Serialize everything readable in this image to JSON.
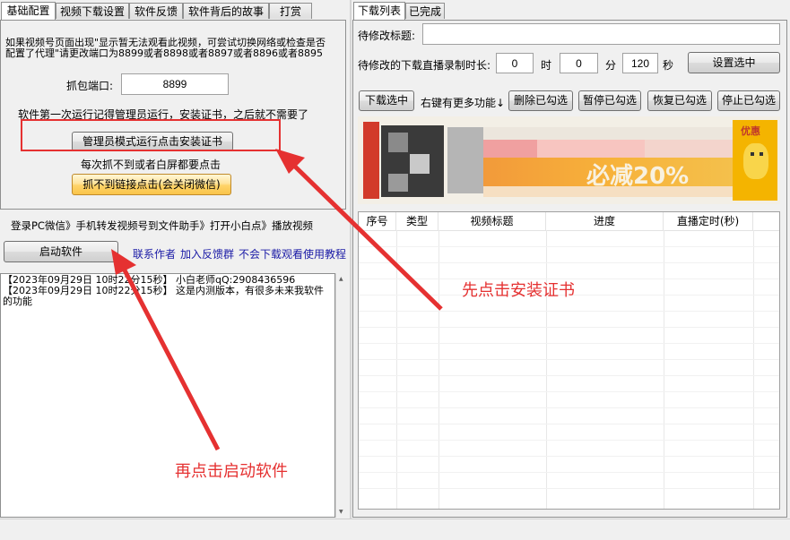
{
  "left_tabs": [
    "基础配置",
    "视频下载设置",
    "软件反馈",
    "软件背后的故事",
    "打赏"
  ],
  "right_tabs": [
    "下载列表",
    "已完成"
  ],
  "hint_text": "如果视频号页面出现\"显示暂无法观看此视频，可尝试切换网络或检查是否配置了代理\"请更改端口为8899或者8898或者8897或者8896或者8895",
  "port_label": "抓包端口:",
  "port_value": "8899",
  "cert_note": "软件第一次运行记得管理员运行，安装证书，之后就不需要了",
  "install_cert_button": "管理员模式运行点击安装证书",
  "refresh_note": "每次抓不到或者白屏都要点击",
  "capture_link_button": "抓不到链接点击(会关闭微信)",
  "flow_text": "登录PC微信》手机转发视频号到文件助手》打开小白点》播放视频",
  "start_button": "启动软件",
  "links": [
    "联系作者",
    "加入反馈群",
    "不会下载观看使用教程"
  ],
  "log_lines": [
    "【2023年09月29日 10时22分15秒】 小白老师qQ:2908436596",
    "【2023年09月29日 10时22分15秒】 这是内测版本，有很多未来我软件的功能"
  ],
  "title_label": "待修改标题:",
  "title_value": "",
  "duration_label": "待修改的下载直播录制时长:",
  "hours_value": "0",
  "hours_unit": "时",
  "minutes_value": "0",
  "minutes_unit": "分",
  "seconds_value": "120",
  "seconds_unit": "秒",
  "set_selected_button": "设置选中",
  "download_selected_button": "下载选中",
  "more_functions_text": "右键有更多功能↓",
  "delete_checked_button": "删除已勾选",
  "pause_checked_button": "暂停已勾选",
  "resume_checked_button": "恢复已勾选",
  "stop_checked_button": "停止已勾选",
  "banner": {
    "headline": "必减20%",
    "badge": "优惠"
  },
  "table_columns": [
    "序号",
    "类型",
    "视频标题",
    "进度",
    "直播定时(秒)"
  ],
  "annotations": {
    "first": "先点击安装证书",
    "second": "再点击启动软件"
  },
  "colors": {
    "annotation_red": "#e53131",
    "highlight_box": "#e53131",
    "link_blue": "#1a1aa6",
    "button_orange": "#ffd469"
  }
}
